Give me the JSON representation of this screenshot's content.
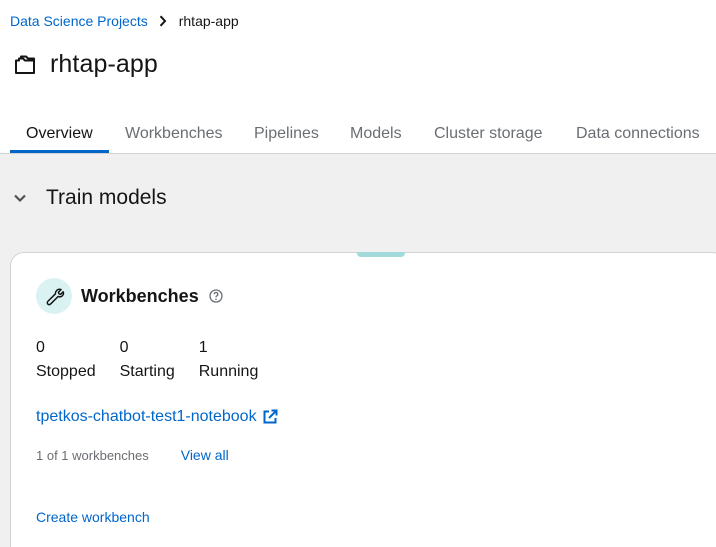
{
  "breadcrumb": {
    "parent": "Data Science Projects",
    "current": "rhtap-app"
  },
  "page": {
    "title": "rhtap-app"
  },
  "tabs": [
    {
      "label": "Overview",
      "active": true
    },
    {
      "label": "Workbenches",
      "active": false
    },
    {
      "label": "Pipelines",
      "active": false
    },
    {
      "label": "Models",
      "active": false
    },
    {
      "label": "Cluster storage",
      "active": false
    },
    {
      "label": "Data connections",
      "active": false
    }
  ],
  "section": {
    "title": "Train models",
    "expanded": true
  },
  "workbenches_card": {
    "title": "Workbenches",
    "stats": [
      {
        "count": "0",
        "label": "Stopped"
      },
      {
        "count": "0",
        "label": "Starting"
      },
      {
        "count": "1",
        "label": "Running"
      }
    ],
    "notebook_link": "tpetkos-chatbot-test1-notebook",
    "count_text": "1 of 1 workbenches",
    "view_all": "View all",
    "create_label": "Create workbench"
  },
  "colors": {
    "link": "#0066cc",
    "active_tab_underline": "#0066cc",
    "section_background": "#f0f0f0",
    "icon_circle": "#daf2f2",
    "card_accent": "#a2d9d9"
  },
  "icons": {
    "breadcrumb_separator": "angle-right-icon",
    "title": "project-folder-icon",
    "section_toggle": "chevron-down-icon",
    "workbench": "wrench-icon",
    "help": "question-circle-icon",
    "external_link": "external-link-icon"
  }
}
